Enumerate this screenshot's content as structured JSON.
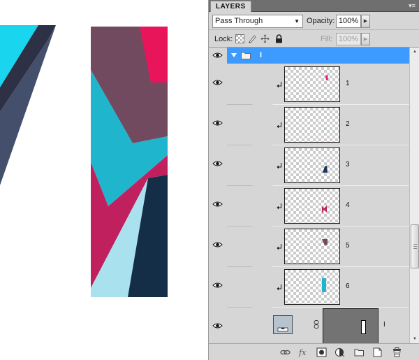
{
  "canvas": {
    "colors": {
      "cyan": "#19d6ee",
      "dark_navy": "#2e3146",
      "slate": "#434f6b",
      "mauve": "#714a60",
      "magenta": "#e8155a",
      "teal": "#1eb5cd",
      "crimson": "#c0215e",
      "light_blue": "#a9e2ee",
      "deep_navy": "#142e47"
    }
  },
  "panel": {
    "tab_label": "LAYERS",
    "menu_icon": "panel-menu-icon",
    "blend_mode": "Pass Through",
    "opacity_label": "Opacity:",
    "opacity_value": "100%",
    "lock_label": "Lock:",
    "fill_label": "Fill:",
    "fill_value": "100%",
    "group": {
      "name": "I"
    },
    "layers": [
      {
        "name": "1",
        "shape_color": "#e0207a"
      },
      {
        "name": "2",
        "shape_color": "#1eb5cd"
      },
      {
        "name": "3",
        "shape_color": "#1e3457"
      },
      {
        "name": "4",
        "shape_color": "#c0215e"
      },
      {
        "name": "5",
        "shape_color": "#714a60"
      },
      {
        "name": "6",
        "shape_color": "#1eb5cd"
      }
    ],
    "base_layer": {
      "name": "I"
    },
    "toolbar": [
      "link-layers-icon",
      "fx-icon",
      "add-mask-icon",
      "adjustment-icon",
      "new-group-icon",
      "new-layer-icon",
      "trash-icon"
    ],
    "accent": "#3d9bff"
  }
}
